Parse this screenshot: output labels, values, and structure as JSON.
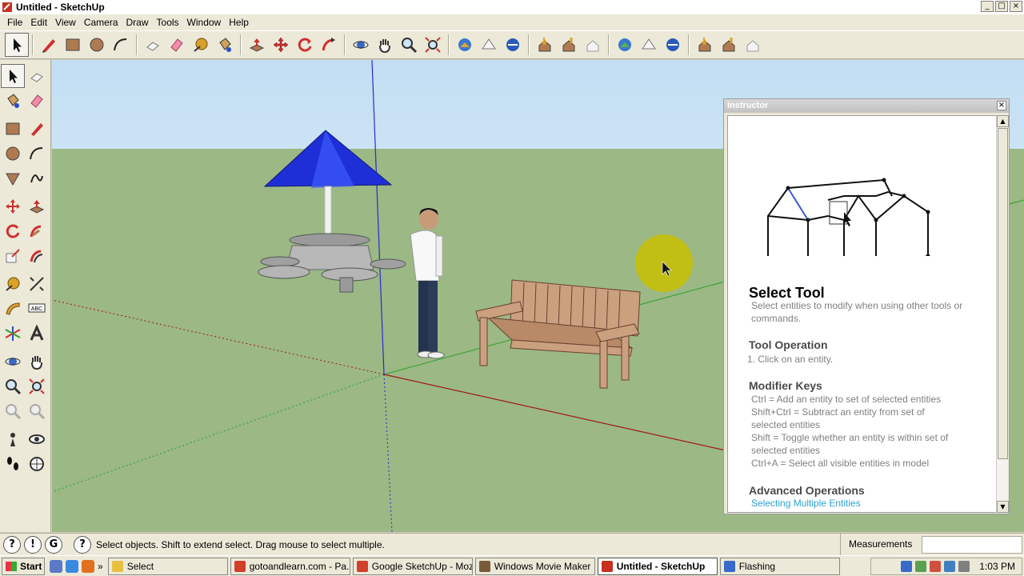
{
  "window": {
    "title": "Untitled - SketchUp",
    "controls": [
      "_",
      "□",
      "×"
    ]
  },
  "menu": [
    "File",
    "Edit",
    "View",
    "Camera",
    "Draw",
    "Tools",
    "Window",
    "Help"
  ],
  "toolbar_icons": [
    "select-icon",
    "pencil-icon",
    "rectangle-icon",
    "circle-icon",
    "arc-icon",
    "make-component-icon",
    "eraser-icon",
    "tape-measure-icon",
    "paint-bucket-icon",
    "push-pull-icon",
    "move-icon",
    "rotate-icon",
    "follow-me-icon",
    "orbit-icon",
    "pan-icon",
    "zoom-icon",
    "zoom-extents-icon",
    "get-models-icon",
    "share-model-icon",
    "share-component-icon",
    "get-photo-texture-icon",
    "place-model-icon",
    "get-current-view-icon",
    "toggle-terrain-icon",
    "add-location-icon",
    "preview-in-earth-icon",
    "photo-texture-icon",
    "upload-icon",
    "download-icon"
  ],
  "left_toolbar_icons": [
    "select-icon",
    "make-component-icon",
    "paint-bucket-icon",
    "eraser-icon",
    "rectangle-icon",
    "line-icon",
    "circle-icon",
    "arc-icon",
    "polygon-icon",
    "freehand-icon",
    "move-icon",
    "push-pull-icon",
    "rotate-icon",
    "follow-me-icon",
    "scale-icon",
    "offset-icon",
    "tape-measure-icon",
    "dimension-icon",
    "protractor-icon",
    "text-icon",
    "axes-icon",
    "3d-text-icon",
    "orbit-icon",
    "pan-icon",
    "zoom-icon",
    "zoom-window-icon",
    "previous-view-icon",
    "next-view-icon",
    "position-camera-icon",
    "look-around-icon",
    "walk-icon",
    "section-plane-icon"
  ],
  "viewport_labels": {
    "text_tool_label": "ABC"
  },
  "instructor": {
    "title": "Instructor",
    "close": "×",
    "heading": "Select Tool",
    "description": "Select entities to modify when using other tools or commands.",
    "tool_operation_heading": "Tool Operation",
    "tool_operation_step": "1.   Click on an entity.",
    "modifier_keys_heading": "Modifier Keys",
    "modifier_lines": [
      "Ctrl = Add an entity to set of selected entities",
      "Shift+Ctrl = Subtract an entity from set of",
      "selected entities",
      "Shift = Toggle whether an entity is within set of",
      "selected entities",
      "Ctrl+A = Select all visible entities in model"
    ],
    "advanced_heading": "Advanced Operations",
    "advanced_link": "Selecting Multiple Entities"
  },
  "status": {
    "icons": [
      "geo-location-icon",
      "credits-icon",
      "sign-in-icon"
    ],
    "help_icon": "?",
    "message": "Select objects. Shift to extend select. Drag mouse to select multiple.",
    "measurements_label": "Measurements",
    "measurements_value": ""
  },
  "taskbar": {
    "start": "Start",
    "more": "»",
    "tasks": [
      {
        "label": "Select",
        "color": "#e8c040",
        "active": false
      },
      {
        "label": "gotoandlearn.com - Pa...",
        "color": "#d0402a",
        "active": false
      },
      {
        "label": "Google SketchUp - Mozi...",
        "color": "#d0402a",
        "active": false
      },
      {
        "label": "Windows Movie Maker",
        "color": "#7a5a3a",
        "active": false
      },
      {
        "label": "Untitled - SketchUp",
        "color": "#c83020",
        "active": true
      },
      {
        "label": "Flashing",
        "color": "#3a6ac8",
        "active": false
      }
    ],
    "clock": "1:03 PM"
  }
}
